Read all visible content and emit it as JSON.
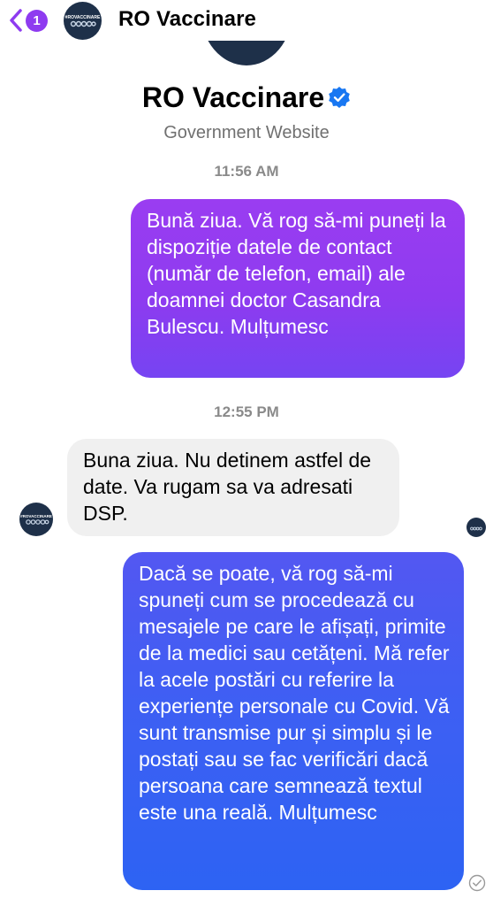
{
  "header": {
    "unread_count": "1",
    "title": "RO Vaccinare"
  },
  "profile": {
    "name": "RO Vaccinare",
    "subtitle": "Government Website",
    "avatar_text": "#ROVACCINARE"
  },
  "conversation": {
    "timestamp_1": "11:56 AM",
    "message_1": "Bună ziua. Vă rog să-mi puneți la dispoziție datele de contact (număr de telefon, email) ale doamnei doctor Casandra Bulescu. Mulțumesc",
    "timestamp_2": "12:55 PM",
    "message_2": "Buna ziua. Nu detinem astfel de date. Va rugam sa va adresati DSP.",
    "message_3": "Dacă se poate, vă rog să-mi spuneți cum se procedează cu mesajele pe care le afișați, primite de la medici sau cetățeni. Mă refer la acele postări cu referire la experiențe personale cu Covid. Vă sunt transmise pur și simplu și le postați sau se fac verificări dacă persoana care semnează textul este una reală. Mulțumesc"
  },
  "colors": {
    "accent": "#8e3bf0",
    "bubble_top": "#9b3cf2",
    "bubble_bottom": "#2d63f3",
    "incoming": "#f0f0f0",
    "avatar_bg": "#1e3049",
    "verified": "#1877f2"
  },
  "icons": {
    "back": "chevron-left-icon",
    "verified": "verified-badge-icon",
    "sent": "sent-check-icon"
  }
}
